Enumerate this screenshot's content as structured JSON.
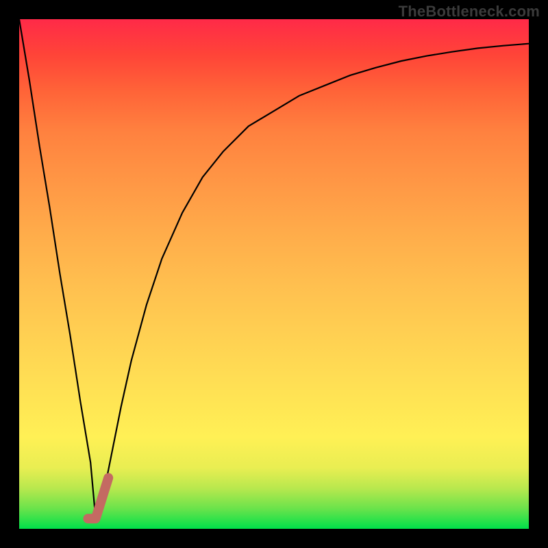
{
  "watermark": "TheBottleneck.com",
  "chart_data": {
    "type": "line",
    "title": "",
    "xlabel": "",
    "ylabel": "",
    "xlim": [
      0,
      100
    ],
    "ylim": [
      0,
      100
    ],
    "background_gradient": {
      "stops": [
        {
          "pos": 0,
          "color": "#00e04a"
        },
        {
          "pos": 18,
          "color": "#fff055"
        },
        {
          "pos": 58,
          "color": "#ffac4a"
        },
        {
          "pos": 100,
          "color": "#ff2a48"
        }
      ],
      "direction": "bottom-to-top"
    },
    "series": [
      {
        "name": "bottleneck-curve",
        "color": "#000000",
        "x": [
          0,
          2,
          4,
          6,
          8,
          10,
          12,
          14,
          15,
          16,
          18,
          20,
          22,
          25,
          28,
          32,
          36,
          40,
          45,
          50,
          55,
          60,
          65,
          70,
          75,
          80,
          85,
          90,
          95,
          100
        ],
        "y": [
          100,
          88,
          75,
          63,
          50,
          38,
          25,
          13,
          2,
          4,
          14,
          24,
          33,
          44,
          53,
          62,
          69,
          74,
          79,
          82,
          85,
          87,
          89,
          90.5,
          91.8,
          92.8,
          93.6,
          94.3,
          94.8,
          95.2
        ]
      }
    ],
    "marker": {
      "name": "highlight-segment",
      "color": "#c46a62",
      "stroke_width_px": 14,
      "points": [
        {
          "x": 13.5,
          "y": 2.0
        },
        {
          "x": 15.0,
          "y": 2.0
        },
        {
          "x": 17.5,
          "y": 10.0
        }
      ]
    }
  }
}
